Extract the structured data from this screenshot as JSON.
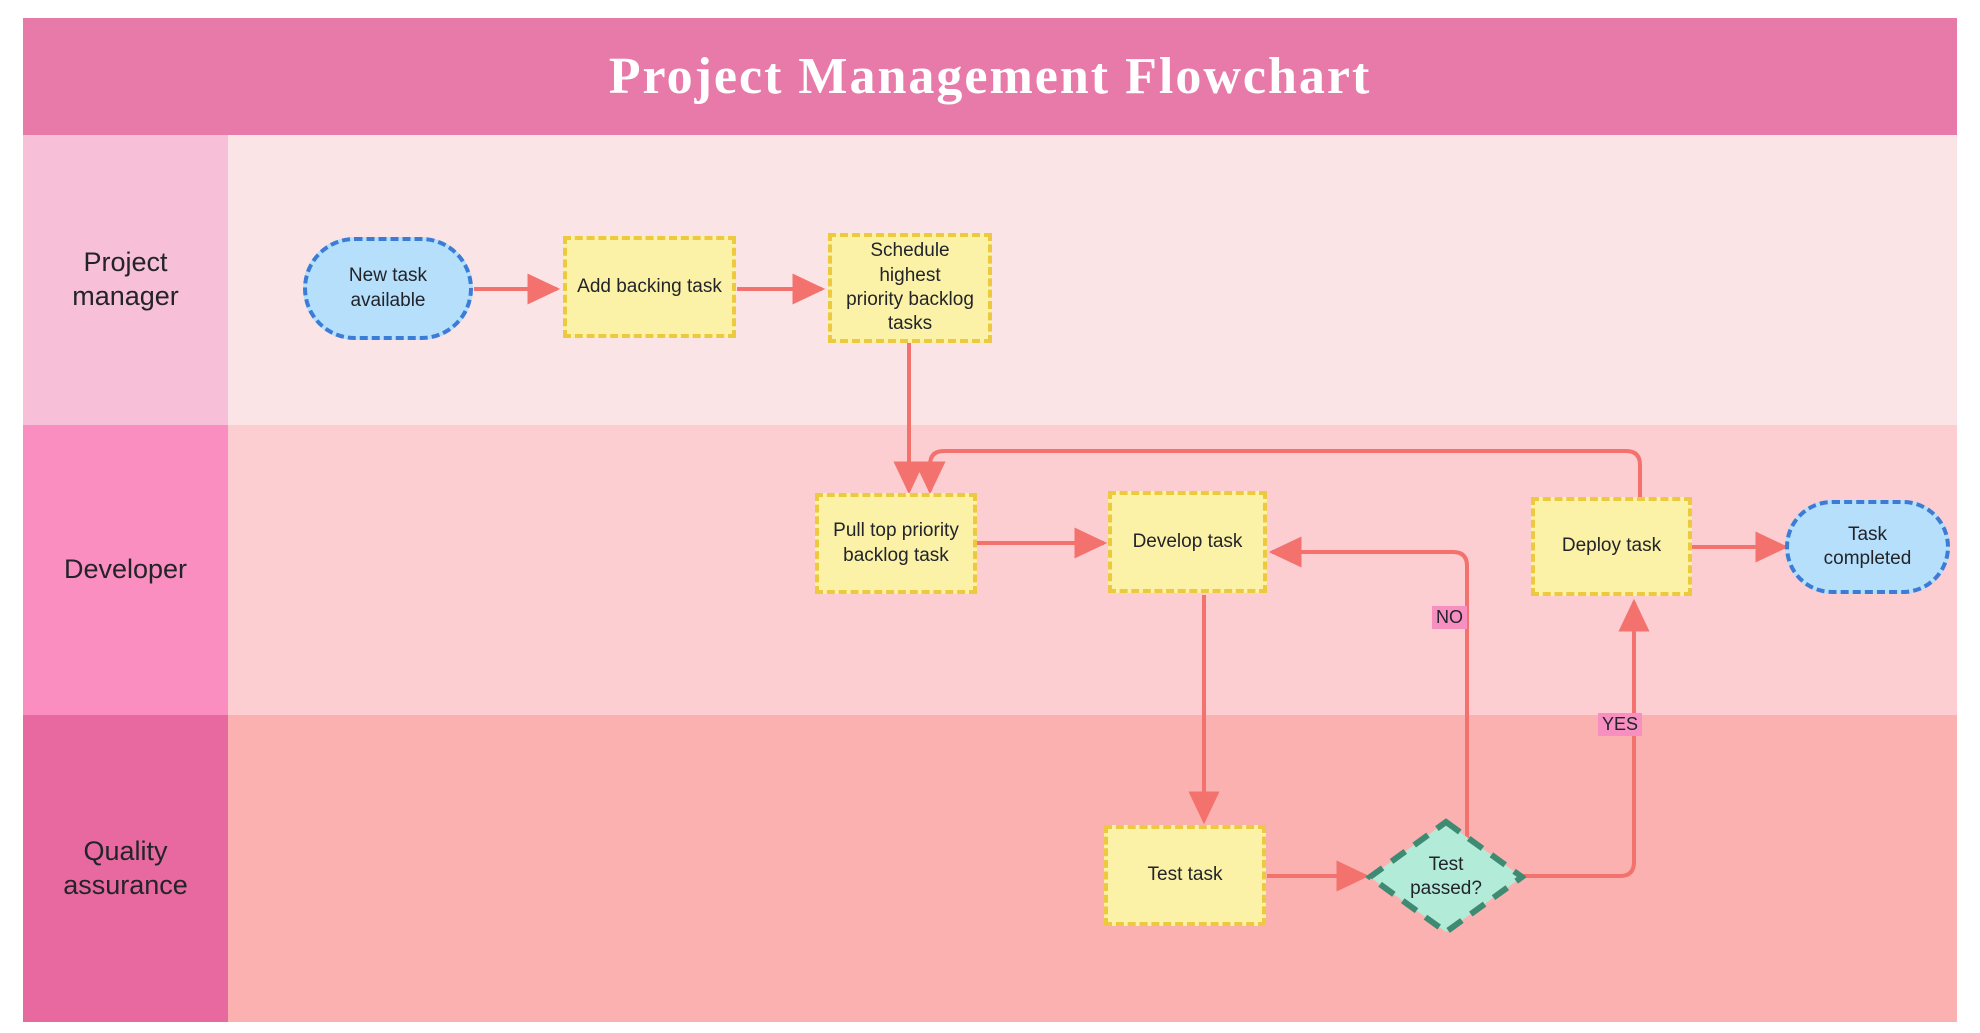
{
  "header": {
    "title": "Project Management Flowchart",
    "background_color": "#e87aa9",
    "text_color": "#ffffff"
  },
  "theme": {
    "process_fill": "#fbf2a8",
    "process_border": "#ecc93f",
    "terminator_fill": "#b5dffb",
    "terminator_border": "#3b7cd6",
    "decision_fill": "#b2ecd8",
    "decision_border": "#3f8a72",
    "connector_color": "#f4726e",
    "label_highlight": "#f78fc0"
  },
  "lanes": [
    {
      "id": "project-manager",
      "label": "Project manager",
      "label_color": "#f8c0d8",
      "body_color": "#fbe4e6"
    },
    {
      "id": "developer",
      "label": "Developer",
      "label_color": "#fb8ec0",
      "body_color": "#fccdd1"
    },
    {
      "id": "quality-assurance",
      "label": "Quality assurance",
      "label_color": "#e8699f",
      "body_color": "#fab1af"
    }
  ],
  "nodes": {
    "new_task_available": {
      "label": "New task\navailable",
      "type": "terminator",
      "lane": "project-manager"
    },
    "add_backing_task": {
      "label": "Add backing task",
      "type": "process",
      "lane": "project-manager"
    },
    "schedule_backlog": {
      "label": "Schedule highest\npriority backlog\ntasks",
      "type": "process",
      "lane": "project-manager"
    },
    "pull_top_priority": {
      "label": "Pull top priority\nbacklog task",
      "type": "process",
      "lane": "developer"
    },
    "develop_task": {
      "label": "Develop task",
      "type": "process",
      "lane": "developer"
    },
    "deploy_task": {
      "label": "Deploy task",
      "type": "process",
      "lane": "developer"
    },
    "task_completed": {
      "label": "Task\ncompleted",
      "type": "terminator",
      "lane": "developer"
    },
    "test_task": {
      "label": "Test task",
      "type": "process",
      "lane": "quality-assurance"
    },
    "test_passed": {
      "label": "Test\npassed?",
      "type": "decision",
      "lane": "quality-assurance"
    }
  },
  "edge_labels": {
    "no": "NO",
    "yes": "YES"
  },
  "edges": [
    {
      "from": "new_task_available",
      "to": "add_backing_task",
      "label": ""
    },
    {
      "from": "add_backing_task",
      "to": "schedule_backlog",
      "label": ""
    },
    {
      "from": "schedule_backlog",
      "to": "pull_top_priority",
      "label": ""
    },
    {
      "from": "pull_top_priority",
      "to": "develop_task",
      "label": ""
    },
    {
      "from": "develop_task",
      "to": "test_task",
      "label": ""
    },
    {
      "from": "test_task",
      "to": "test_passed",
      "label": ""
    },
    {
      "from": "test_passed",
      "to": "develop_task",
      "label": "NO"
    },
    {
      "from": "test_passed",
      "to": "deploy_task",
      "label": "YES"
    },
    {
      "from": "deploy_task",
      "to": "pull_top_priority",
      "label": ""
    },
    {
      "from": "deploy_task",
      "to": "task_completed",
      "label": ""
    }
  ]
}
